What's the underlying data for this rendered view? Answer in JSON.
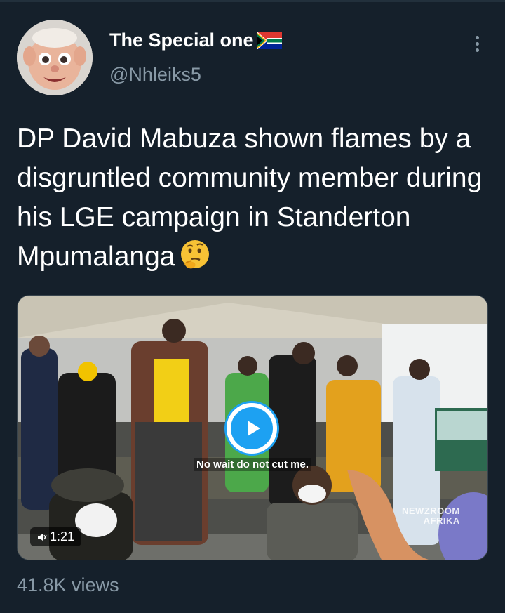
{
  "tweet": {
    "display_name": "The Special one",
    "flag_icon": "south-africa-flag-icon",
    "handle": "@Nhleiks5",
    "text": "DP David Mabuza shown flames by a disgruntled community member during his LGE campaign in Standerton Mpumalanga",
    "emoji": "thinking-face-emoji",
    "views": "41.8K views"
  },
  "video": {
    "caption": "No wait do not cut me.",
    "duration": "1:21",
    "watermark_line1": "NEWZROOM",
    "watermark_line2": "AFRIKA"
  },
  "colors": {
    "background": "#15202b",
    "secondary_text": "#8899a6",
    "accent": "#1da1f2"
  }
}
